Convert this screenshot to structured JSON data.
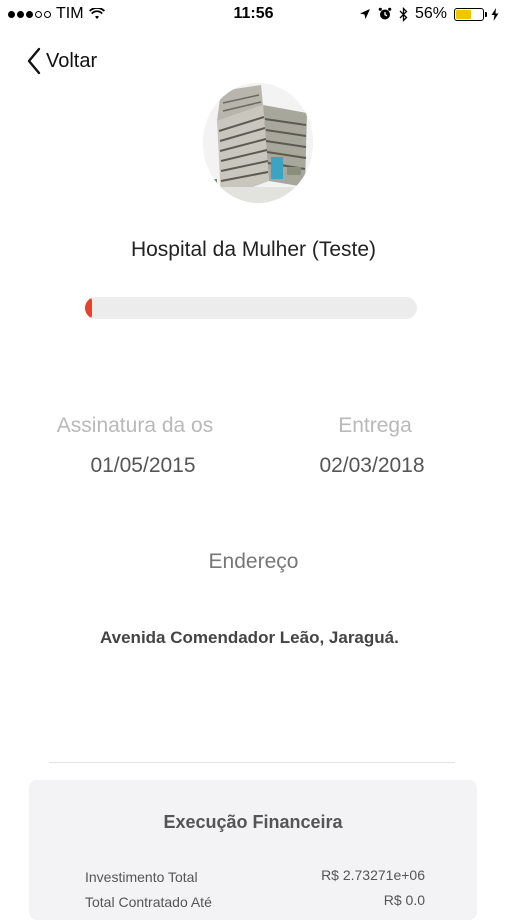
{
  "status_bar": {
    "carrier": "TIM",
    "time": "11:56",
    "battery_percent": "56%",
    "battery_level": 0.56
  },
  "nav": {
    "back_label": "Voltar"
  },
  "project": {
    "title": "Hospital da Mulher (Teste)",
    "progress": 0.02,
    "progress_color": "#e8412c"
  },
  "dates": {
    "signature_label": "Assinatura da os",
    "signature_value": "01/05/2015",
    "delivery_label": "Entrega",
    "delivery_value": "02/03/2018"
  },
  "address": {
    "label": "Endereço",
    "value": "Avenida Comendador Leão, Jaraguá."
  },
  "financial": {
    "title": "Execução Financeira",
    "rows": [
      {
        "label": "Investimento Total",
        "value": "R$ 2.73271e+06"
      },
      {
        "label": "Total Contratado Até",
        "value": "R$ 0.0"
      }
    ]
  }
}
